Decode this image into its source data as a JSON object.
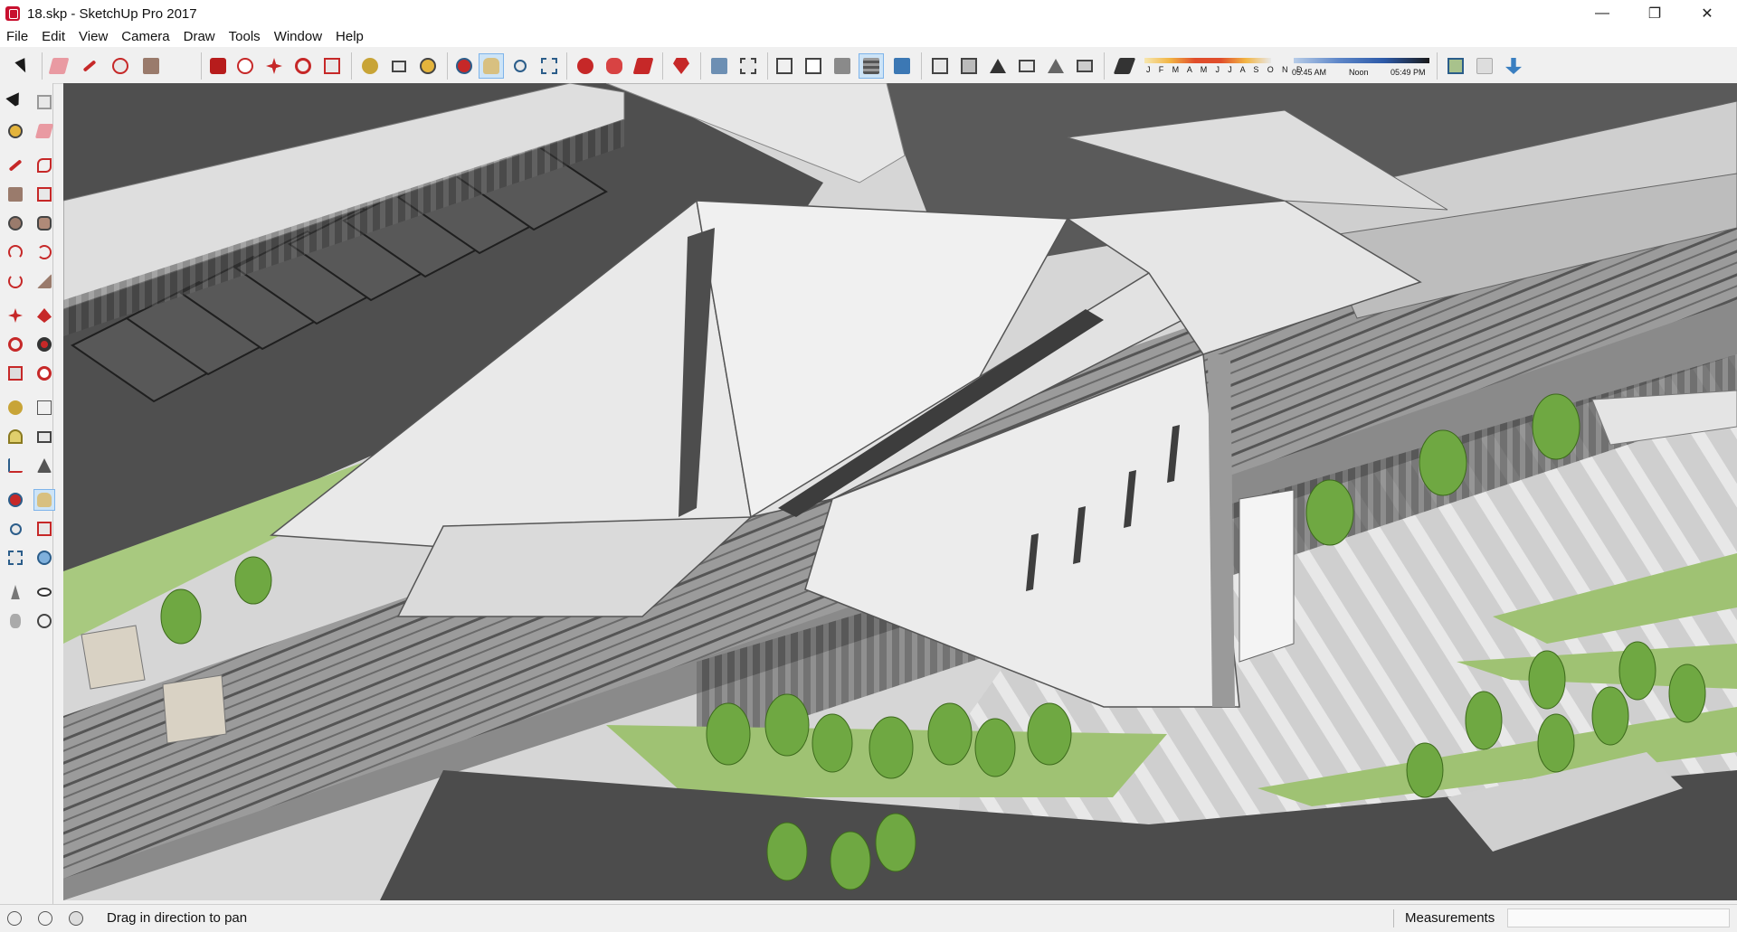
{
  "window": {
    "title": "18.skp - SketchUp Pro 2017",
    "controls": {
      "minimize": "—",
      "maximize": "❐",
      "close": "✕"
    }
  },
  "menu": [
    "File",
    "Edit",
    "View",
    "Camera",
    "Draw",
    "Tools",
    "Window",
    "Help"
  ],
  "shadow_settings": {
    "months": "J F M A M J J A S O N D",
    "time_start": "05:45 AM",
    "time_mid": "Noon",
    "time_end": "05:49 PM"
  },
  "toolbar_icons": [
    "select-icon",
    "eraser-icon",
    "pencil-icon",
    "arc-icon",
    "rectangle-icon",
    "push-pull-icon",
    "follow-me-icon",
    "move-icon",
    "rotate-icon",
    "scale-icon",
    "tape-measure-icon",
    "text-icon",
    "paint-bucket-icon",
    "orbit-icon",
    "pan-icon",
    "zoom-icon",
    "zoom-extents-icon",
    "warehouse-icon",
    "extension-warehouse-icon",
    "layout-icon",
    "ruby-icon",
    "xray-icon",
    "back-edges-icon",
    "wireframe-icon",
    "hidden-line-icon",
    "shaded-icon",
    "shaded-textures-icon",
    "monochrome-icon",
    "iso-view-icon",
    "top-view-icon",
    "front-view-icon",
    "right-view-icon",
    "back-view-icon",
    "left-view-icon",
    "shadows-icon",
    "section-icon"
  ],
  "left_tools": [
    "select-icon",
    "component-icon",
    "paint-bucket-icon",
    "eraser-icon",
    "line-icon",
    "freehand-icon",
    "rectangle-icon",
    "rotated-rectangle-icon",
    "circle-icon",
    "polygon-icon",
    "arc-icon",
    "pie-icon",
    "two-point-arc-icon",
    "three-point-arc-icon",
    "move-icon",
    "push-pull-icon",
    "rotate-icon",
    "follow-me-icon",
    "scale-icon",
    "offset-icon",
    "tape-measure-icon",
    "axes-icon",
    "protractor-icon",
    "text-icon",
    "dimension-icon",
    "3d-text-icon",
    "orbit-icon",
    "pan-icon",
    "zoom-icon",
    "zoom-window-icon",
    "zoom-extents-icon",
    "previous-view-icon",
    "position-camera-icon",
    "look-around-icon",
    "walk-icon",
    "section-plane-icon"
  ],
  "status": {
    "message": "Drag in direction to pan",
    "measurements_label": "Measurements",
    "measurements_value": ""
  },
  "viewport": {
    "model": "railway-station-model",
    "sky": "#d6d6d6",
    "roof": "#ececec",
    "grass": "#a8c97f",
    "asphalt": "#5a5a5a",
    "tree": "#6fa842"
  }
}
